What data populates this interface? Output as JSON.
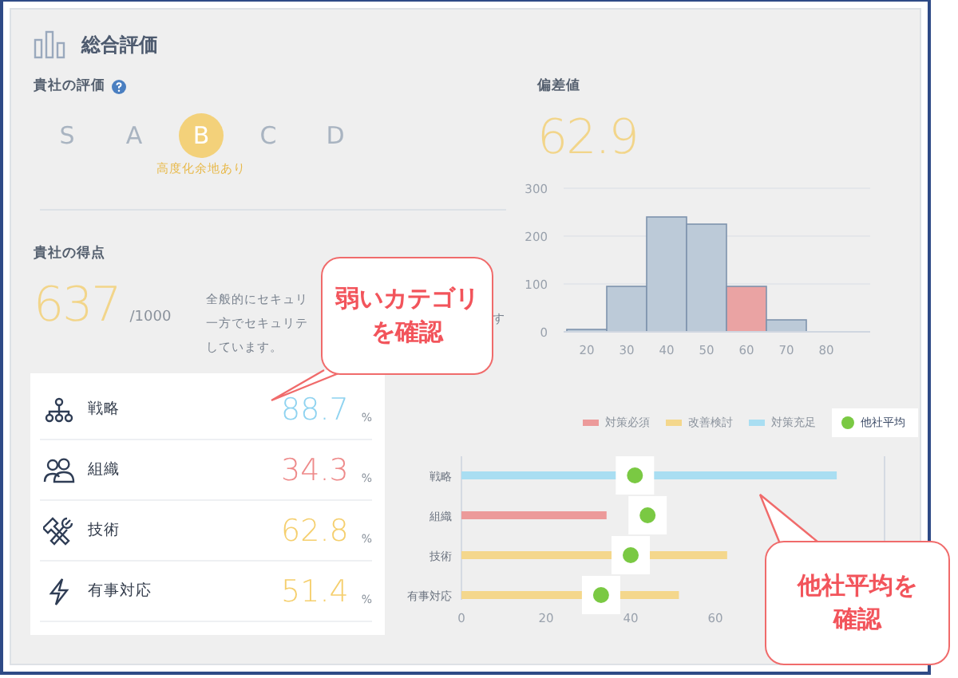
{
  "title": "総合評価",
  "rating": {
    "label": "貴社の評価",
    "grades": [
      {
        "letter": "S",
        "selected": false
      },
      {
        "letter": "A",
        "selected": false
      },
      {
        "letter": "B",
        "selected": true,
        "note": "高度化余地あり"
      },
      {
        "letter": "C",
        "selected": false
      },
      {
        "letter": "D",
        "selected": false
      }
    ]
  },
  "score": {
    "label": "貴社の得点",
    "value": "637",
    "max": "/1000",
    "description_lines": [
      "全般的にセキュリ",
      "一方でセキュリテ",
      "しています。"
    ],
    "description_tail": "す"
  },
  "categories": [
    {
      "kind": "strategy",
      "name": "戦略",
      "value": "88.7",
      "unit": "%",
      "color": "#8fd3f0"
    },
    {
      "kind": "organization",
      "name": "組織",
      "value": "34.3",
      "unit": "%",
      "color": "#ee8a8a"
    },
    {
      "kind": "technology",
      "name": "技術",
      "value": "62.8",
      "unit": "%",
      "color": "#f5cf6e"
    },
    {
      "kind": "incident",
      "name": "有事対応",
      "value": "51.4",
      "unit": "%",
      "color": "#f5cf6e"
    }
  ],
  "deviation": {
    "label": "偏差値",
    "value": "62.9",
    "chart_data": {
      "type": "bar",
      "categories": [
        "20",
        "30",
        "40",
        "50",
        "60",
        "70",
        "80"
      ],
      "ylim": [
        0,
        300
      ],
      "yticks": [
        0,
        100,
        200,
        300
      ],
      "series": [
        {
          "color": "#bccad8",
          "values": [
            5,
            95,
            240,
            225,
            null,
            25,
            null
          ]
        },
        {
          "color": "#eaa3a3",
          "values": [
            null,
            null,
            null,
            null,
            95,
            null,
            null
          ]
        }
      ]
    }
  },
  "legend": [
    {
      "label": "対策必須",
      "color": "#ec9a9a"
    },
    {
      "label": "改善検討",
      "color": "#f4d78c"
    },
    {
      "label": "対策充足",
      "color": "#a9def2"
    }
  ],
  "comparison": {
    "chart_data": {
      "type": "bar",
      "orientation": "horizontal",
      "categories": [
        "戦略",
        "組織",
        "技術",
        "有事対応"
      ],
      "xlim": [
        0,
        100
      ],
      "xticks": [
        0,
        20,
        40,
        60
      ],
      "series": [
        {
          "colors": [
            "#a9def2",
            "#ec9a9a",
            "#f4d78c",
            "#f4d78c"
          ],
          "values": [
            88.7,
            34.3,
            62.8,
            51.4
          ]
        },
        {
          "name": "他社平均",
          "type": "scatter",
          "color": "#7ac943",
          "values": [
            41,
            44,
            40,
            33
          ]
        }
      ]
    }
  },
  "callouts": [
    {
      "lines": [
        "弱いカテゴリ",
        "を確認"
      ]
    },
    {
      "lines": [
        "他社平均を",
        "確認"
      ]
    }
  ]
}
